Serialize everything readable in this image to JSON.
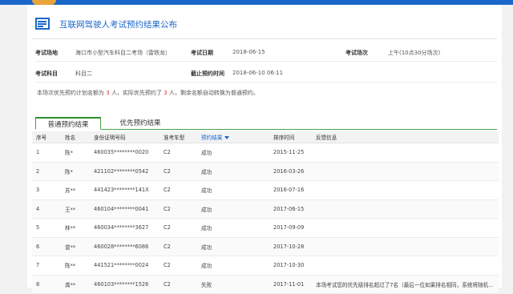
{
  "page": {
    "title": "互联网驾驶人考试预约结果公布"
  },
  "info": {
    "exam_site_label": "考试场地",
    "exam_site_value": "海口市小型汽车科目二考场（雷铁龙）",
    "exam_date_label": "考试日期",
    "exam_date_value": "2018-06-15",
    "exam_session_label": "考试场次",
    "exam_session_value": "上午(10点30分场次)",
    "exam_subject_label": "考试科目",
    "exam_subject_value": "科目二",
    "deadline_label": "截止预约时间",
    "deadline_value": "2018-06-10 06:11"
  },
  "notice": {
    "part1": "本场次优先预约计划名额为",
    "planned": "3",
    "part2": "人，实际优先预约了",
    "actual": "3",
    "part3": "人，剩余名额自动转换为普通预约。"
  },
  "tabs": [
    "普通预约结果",
    "优先预约结果"
  ],
  "table": {
    "headers": {
      "no": "序号",
      "name": "姓名",
      "id": "身份证明号码",
      "vehicle": "准考车型",
      "result": "预约结果",
      "time": "排序时间",
      "feedback": "反馈信息"
    },
    "rows": [
      {
        "no": "1",
        "name": "陈*",
        "id": "460035********0020",
        "vehicle": "C2",
        "result": "成功",
        "time": "2015-11-25",
        "feedback": ""
      },
      {
        "no": "2",
        "name": "陈*",
        "id": "421102********0542",
        "vehicle": "C2",
        "result": "成功",
        "time": "2016-03-26",
        "feedback": ""
      },
      {
        "no": "3",
        "name": "苏**",
        "id": "441423********141X",
        "vehicle": "C2",
        "result": "成功",
        "time": "2016-07-16",
        "feedback": ""
      },
      {
        "no": "4",
        "name": "王**",
        "id": "460104********0041",
        "vehicle": "C2",
        "result": "成功",
        "time": "2017-06-15",
        "feedback": ""
      },
      {
        "no": "5",
        "name": "林**",
        "id": "460034********3627",
        "vehicle": "C2",
        "result": "成功",
        "time": "2017-09-09",
        "feedback": ""
      },
      {
        "no": "6",
        "name": "曾**",
        "id": "460028********6086",
        "vehicle": "C2",
        "result": "成功",
        "time": "2017-10-28",
        "feedback": ""
      },
      {
        "no": "7",
        "name": "陈**",
        "id": "441521********0024",
        "vehicle": "C2",
        "result": "成功",
        "time": "2017-10-30",
        "feedback": ""
      },
      {
        "no": "8",
        "name": "龚**",
        "id": "460103********1526",
        "vehicle": "C2",
        "result": "失败",
        "time": "2017-11-01",
        "feedback": "本场考试您的优先级排名超过了7名（最后一位如果排名相同，系统将随机..."
      }
    ]
  },
  "colors": {
    "brand": "#1b66c9",
    "success": "#35a335",
    "fail": "#e53333",
    "tab_accent": "#4aa34a"
  }
}
